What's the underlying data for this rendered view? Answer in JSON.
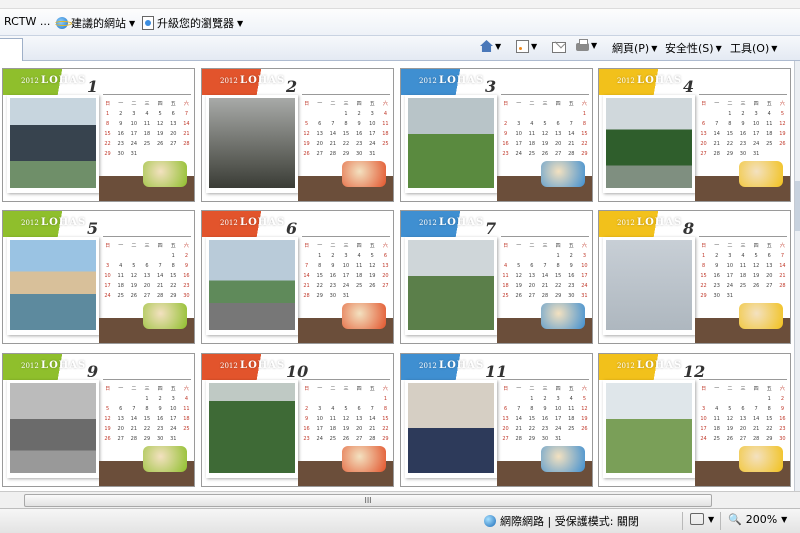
{
  "favorites_bar": {
    "items": [
      {
        "label": "RCTW ...",
        "icon": "none"
      },
      {
        "label": "建議的網站",
        "icon": "ie-icon"
      },
      {
        "label": "升級您的瀏覽器",
        "icon": "page-icon"
      }
    ]
  },
  "command_bar": {
    "icons": [
      "home-icon",
      "rss-icon",
      "mail-icon",
      "print-icon"
    ],
    "menus": [
      "網頁(P)",
      "安全性(S)",
      "工具(O)"
    ]
  },
  "calendar": {
    "brand": "LOHAS",
    "year": "2012",
    "weekday_header": [
      "日",
      "一",
      "二",
      "三",
      "四",
      "五",
      "六"
    ],
    "months": [
      {
        "number": "1",
        "color": "#8fbf2c",
        "photo": "group-photo"
      },
      {
        "number": "2",
        "color": "#e2542c",
        "photo": "rc-plane-dark"
      },
      {
        "number": "3",
        "color": "#3f8fd1",
        "photo": "person-with-plane"
      },
      {
        "number": "4",
        "color": "#f2c11b",
        "photo": "plane-over-trees"
      },
      {
        "number": "5",
        "color": "#8fbf2c",
        "photo": "couple-photo"
      },
      {
        "number": "6",
        "color": "#e2542c",
        "photo": "plane-on-ground"
      },
      {
        "number": "7",
        "color": "#3f8fd1",
        "photo": "people-holding-plane"
      },
      {
        "number": "8",
        "color": "#f2c11b",
        "photo": "plane-in-sky"
      },
      {
        "number": "9",
        "color": "#8fbf2c",
        "photo": "bw-two-men"
      },
      {
        "number": "10",
        "color": "#e2542c",
        "photo": "plane-over-field"
      },
      {
        "number": "11",
        "color": "#3f8fd1",
        "photo": "three-men-indoors"
      },
      {
        "number": "12",
        "color": "#f2c11b",
        "photo": "group-outdoors"
      }
    ]
  },
  "status_bar": {
    "zone": "網際網路 | 受保護模式: 關閉",
    "zoom": "200%"
  },
  "scrollbar": {
    "grip": "III"
  }
}
